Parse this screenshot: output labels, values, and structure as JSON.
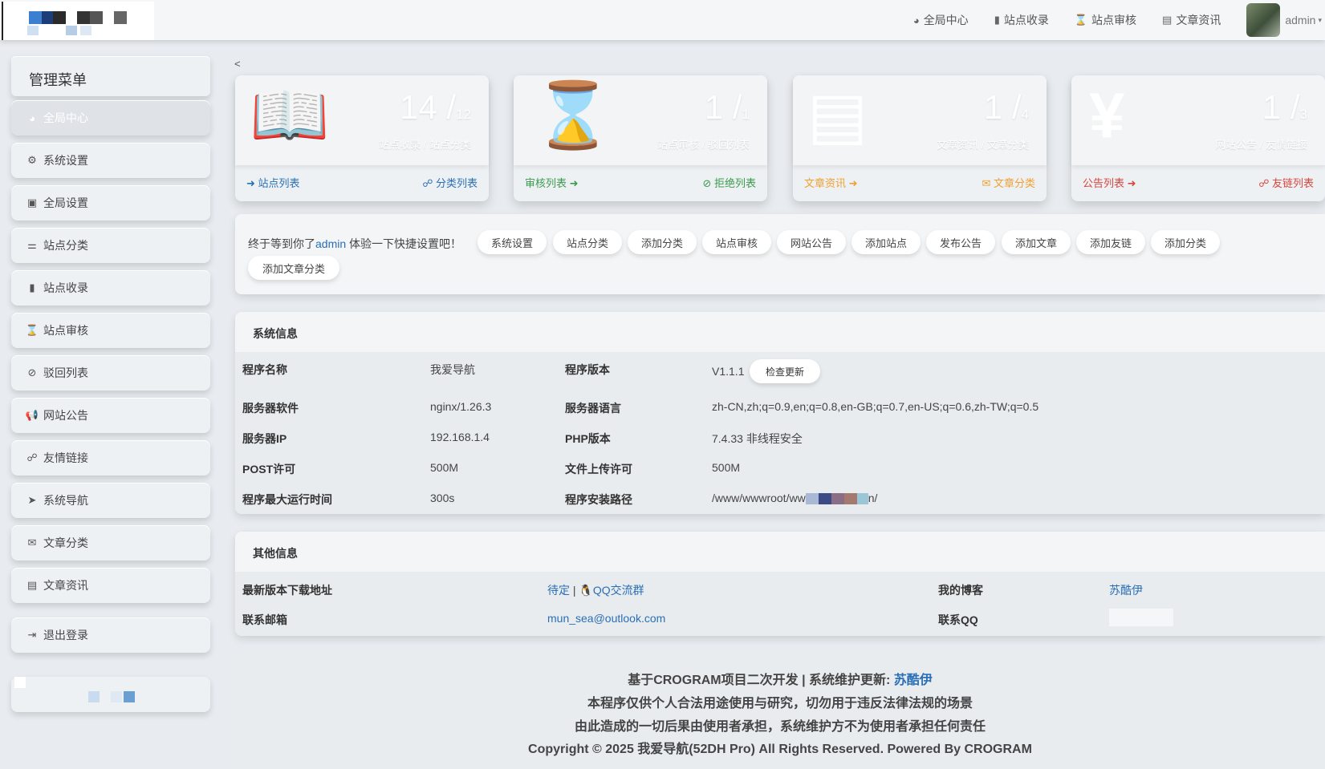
{
  "topnav": {
    "items": [
      {
        "icon": "dashboard-icon",
        "glyph": "◕",
        "label": "全局中心"
      },
      {
        "icon": "book-icon",
        "glyph": "▮",
        "label": "站点收录"
      },
      {
        "icon": "hourglass-icon",
        "glyph": "⌛",
        "label": "站点审核"
      },
      {
        "icon": "newspaper-icon",
        "glyph": "▤",
        "label": "文章资讯"
      }
    ],
    "user": "admin"
  },
  "sidebar": {
    "title": "管理菜单",
    "items": [
      {
        "glyph": "◕",
        "label": "全局中心"
      },
      {
        "glyph": "⚙",
        "label": "系统设置"
      },
      {
        "glyph": "▣",
        "label": "全局设置"
      },
      {
        "glyph": "⚌",
        "label": "站点分类"
      },
      {
        "glyph": "▮",
        "label": "站点收录"
      },
      {
        "glyph": "⌛",
        "label": "站点审核"
      },
      {
        "glyph": "⊘",
        "label": "驳回列表"
      },
      {
        "glyph": "📢",
        "label": "网站公告"
      },
      {
        "glyph": "☍",
        "label": "友情链接"
      },
      {
        "glyph": "➤",
        "label": "系统导航"
      },
      {
        "glyph": "✉",
        "label": "文章分类"
      },
      {
        "glyph": "▤",
        "label": "文章资讯"
      }
    ],
    "logout": {
      "glyph": "⇥",
      "label": "退出登录"
    }
  },
  "collapse_label": "<",
  "cards": [
    {
      "icon": "📖",
      "num": "14",
      "den": "12",
      "sub": "站点收录 / 站点分类",
      "left": {
        "glyph": "➜",
        "label": "站点列表"
      },
      "right": {
        "glyph": "☍",
        "label": "分类列表"
      },
      "color": "#2a6fb5"
    },
    {
      "icon": "⌛",
      "num": "1",
      "den": "1",
      "sub": "站点审核 / 驳回列表",
      "left": {
        "glyph": "➜",
        "label": "审核列表"
      },
      "right": {
        "glyph": "⊘",
        "label": "拒绝列表"
      },
      "color": "#3b9a4e"
    },
    {
      "icon": "▤",
      "num": "1",
      "den": "4",
      "sub": "文章资讯 / 文章分类",
      "left": {
        "glyph": "➜",
        "label": "文章资讯"
      },
      "right": {
        "glyph": "✉",
        "label": "文章分类"
      },
      "color": "#f0a030"
    },
    {
      "icon": "¥",
      "num": "1",
      "den": "3",
      "sub": "网站公告 / 友情链接",
      "left": {
        "glyph": "➜",
        "label": "公告列表"
      },
      "right": {
        "glyph": "☍",
        "label": "友链列表"
      },
      "color": "#d9453d"
    }
  ],
  "quick": {
    "intro_pre": "终于等到你了",
    "intro_user": "admin",
    "intro_post": " 体验一下快捷设置吧！",
    "buttons": [
      "系统设置",
      "站点分类",
      "添加分类",
      "站点审核",
      "网站公告",
      "添加站点",
      "发布公告",
      "添加文章",
      "添加友链",
      "添加分类",
      "添加文章分类"
    ]
  },
  "sysinfo": {
    "title": "系统信息",
    "rows": [
      {
        "k1": "程序名称",
        "v1": "我爱导航",
        "k2": "程序版本",
        "v2": "V1.1.1"
      },
      {
        "k1": "服务器软件",
        "v1": "nginx/1.26.3",
        "k2": "服务器语言",
        "v2": "zh-CN,zh;q=0.9,en;q=0.8,en-GB;q=0.7,en-US;q=0.6,zh-TW;q=0.5"
      },
      {
        "k1": "服务器IP",
        "v1": "192.168.1.4",
        "k2": "PHP版本",
        "v2": "7.4.33 非线程安全"
      },
      {
        "k1": "POST许可",
        "v1": "500M",
        "k2": "文件上传许可",
        "v2": "500M"
      },
      {
        "k1": "程序最大运行时间",
        "v1": "300s",
        "k2": "程序安装路径",
        "v2": "/www/wwwroot/ww"
      }
    ],
    "check_update": "检查更新",
    "path_suffix": "n/"
  },
  "otherinfo": {
    "title": "其他信息",
    "download_label": "最新版本下载地址",
    "download_pending": "待定",
    "sep": "|",
    "qq_group": "QQ交流群",
    "blog_label": "我的博客",
    "blog_value": "苏酷伊",
    "email_label": "联系邮箱",
    "email_value": "mun_sea@outlook.com",
    "qq_label": "联系QQ"
  },
  "footer": {
    "line1_pre": "基于CROGRAM项目二次开发 | 系统维护更新: ",
    "line1_name": "苏酷伊",
    "line2": "本程序仅供个人合法用途使用与研究，切勿用于违反法律法规的场景",
    "line3": "由此造成的一切后果由使用者承担，系统维护方不为使用者承担任何责任",
    "line4": "Copyright © 2025 我爱导航(52DH Pro) All Rights Reserved. Powered By CROGRAM"
  }
}
